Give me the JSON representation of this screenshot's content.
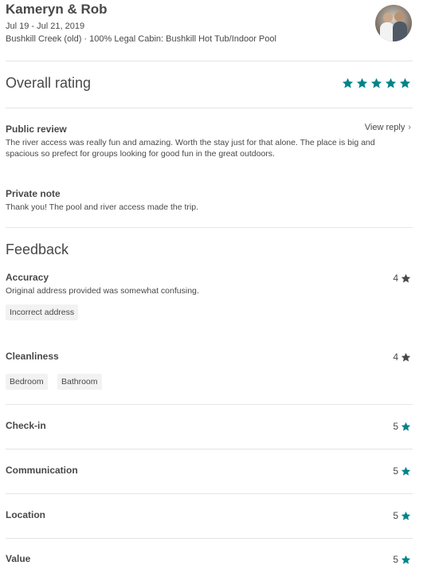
{
  "header": {
    "guest_name": "Kameryn & Rob",
    "dates": "Jul 19 - Jul 21, 2019",
    "listing": "Bushkill Creek (old) · 100% Legal Cabin: Bushkill Hot Tub/Indoor Pool"
  },
  "overall": {
    "label": "Overall rating",
    "stars": 5
  },
  "public_review": {
    "title": "Public review",
    "view_reply": "View reply",
    "text": "The river access was really fun and amazing. Worth the stay just for that alone. The place is big and spacious so prefect for groups looking for good fun in the great outdoors."
  },
  "private_note": {
    "title": "Private note",
    "text": "Thank you! The pool and river access made the trip."
  },
  "feedback": {
    "title": "Feedback",
    "items": [
      {
        "label": "Accuracy",
        "score": "4",
        "comment": "Original address provided was somewhat confusing.",
        "tags": [
          "Incorrect address"
        ]
      },
      {
        "label": "Cleanliness",
        "score": "4",
        "tags": [
          "Bedroom",
          "Bathroom"
        ]
      },
      {
        "label": "Check-in",
        "score": "5"
      },
      {
        "label": "Communication",
        "score": "5"
      },
      {
        "label": "Location",
        "score": "5"
      },
      {
        "label": "Value",
        "score": "5"
      }
    ]
  },
  "colors": {
    "teal_star": "#008489",
    "dark_star": "#484848",
    "text": "#484848",
    "divider": "#e4e4e4",
    "tag_bg": "#f2f2f2"
  },
  "icons": {
    "star": "star-icon",
    "chevron": "chevron-right-icon"
  }
}
